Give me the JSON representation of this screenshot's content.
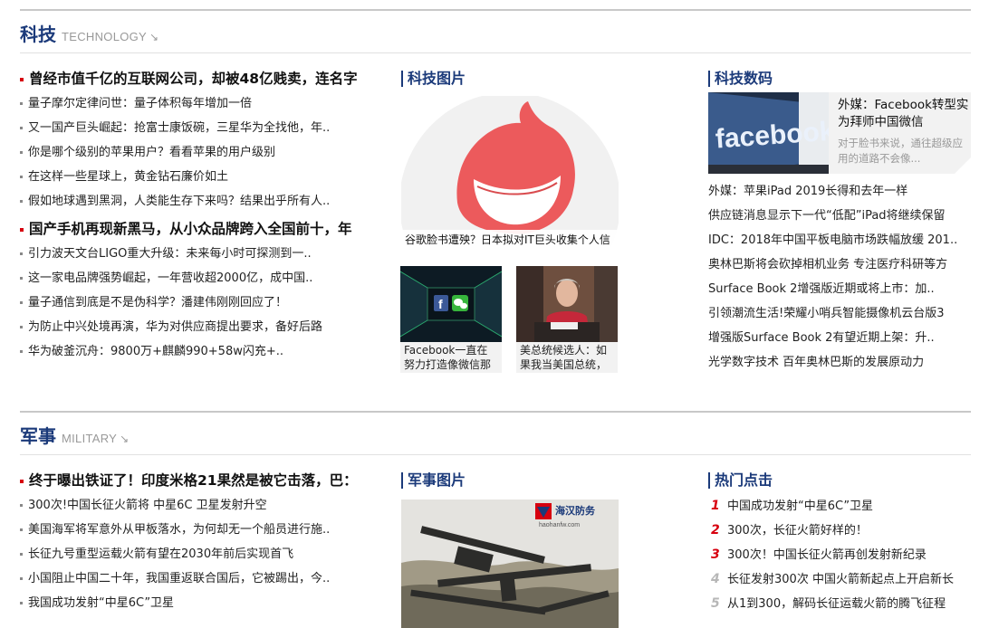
{
  "tech": {
    "title_cn": "科技",
    "title_en": "TECHNOLOGY",
    "arrow": "↘",
    "headlines": [
      {
        "text": "曾经市值千亿的互联网公司，却被48亿贱卖，连名字",
        "items": [
          "量子摩尔定律问世：量子体积每年增加一倍",
          "又一国产巨头崛起：抢富士康饭碗，三星华为全找他，年..",
          "你是哪个级别的苹果用户？看看苹果的用户级别",
          "在这样一些星球上，黄金钻石廉价如土",
          "假如地球遇到黑洞，人类能生存下来吗？结果出乎所有人.."
        ]
      },
      {
        "text": "国产手机再现新黑马，从小众品牌跨入全国前十，年",
        "items": [
          "引力波天文台LIGO重大升级：未来每小时可探测到一..",
          "这一家电品牌强势崛起，一年营收超2000亿，成中国..",
          "量子通信到底是不是伪科学？潘建伟刚刚回应了！",
          "为防止中兴处境再演，华为对供应商提出要求，备好后路",
          "华为破釜沉舟：9800万+麒麟990+58w闪充+.."
        ]
      }
    ],
    "pictures": {
      "heading": "科技图片",
      "main_caption": "谷歌脸书遭殃？日本拟对IT巨头收集个人信",
      "thumbs": [
        {
          "caption": "Facebook一直在努力打造像微信那样"
        },
        {
          "caption": "美总统候选人：如果我当美国总统，"
        }
      ]
    },
    "digital": {
      "heading": "科技数码",
      "feature_title": "外媒：Facebook转型实为拜师中国微信",
      "feature_desc": "对于脸书来说，通往超级应用的道路不会像...",
      "feature_img_text": "facebook",
      "items": [
        "外媒：苹果iPad 2019长得和去年一样",
        "供应链消息显示下一代“低配”iPad将继续保留",
        "IDC：2018年中国平板电脑市场跌幅放缓 201..",
        "奥林巴斯将会砍掉相机业务 专注医疗科研等方",
        "Surface Book 2增强版近期或将上市：加..",
        "引领潮流生活!荣耀小哨兵智能摄像机云台版3",
        "增强版Surface Book 2有望近期上架：升..",
        "光学数字技术 百年奥林巴斯的发展原动力"
      ]
    }
  },
  "military": {
    "title_cn": "军事",
    "title_en": "MILITARY",
    "arrow": "↘",
    "headline": "终于曝出铁证了！印度米格21果然是被它击落，巴：",
    "items": [
      "300次!中国长征火箭将 中星6C 卫星发射升空",
      "美国海军将军意外从甲板落水，为何却无一个船员进行施..",
      "长征九号重型运载火箭有望在2030年前后实现首飞",
      "小国阻止中国二十年，我国重返联合国后，它被踢出，今..",
      "我国成功发射“中星6C”卫星"
    ],
    "pictures": {
      "heading": "军事图片",
      "logo_text": "海汉防务",
      "logo_sub": "haohanfw.com"
    },
    "hot": {
      "heading": "热门点击",
      "items": [
        {
          "rank": "1",
          "text": "中国成功发射“中星6C”卫星"
        },
        {
          "rank": "2",
          "text": "300次，长征火箭好样的！"
        },
        {
          "rank": "3",
          "text": "300次！中国长征火箭再创发射新纪录"
        },
        {
          "rank": "4",
          "text": "长征发射300次 中国火箭新起点上开启新长"
        },
        {
          "rank": "5",
          "text": "从1到300，解码长征运载火箭的腾飞征程"
        }
      ]
    }
  },
  "colors": {
    "heading_blue": "#1b3a7a",
    "accent_red": "#d7000f",
    "divider_gray": "#c8c8c8"
  }
}
